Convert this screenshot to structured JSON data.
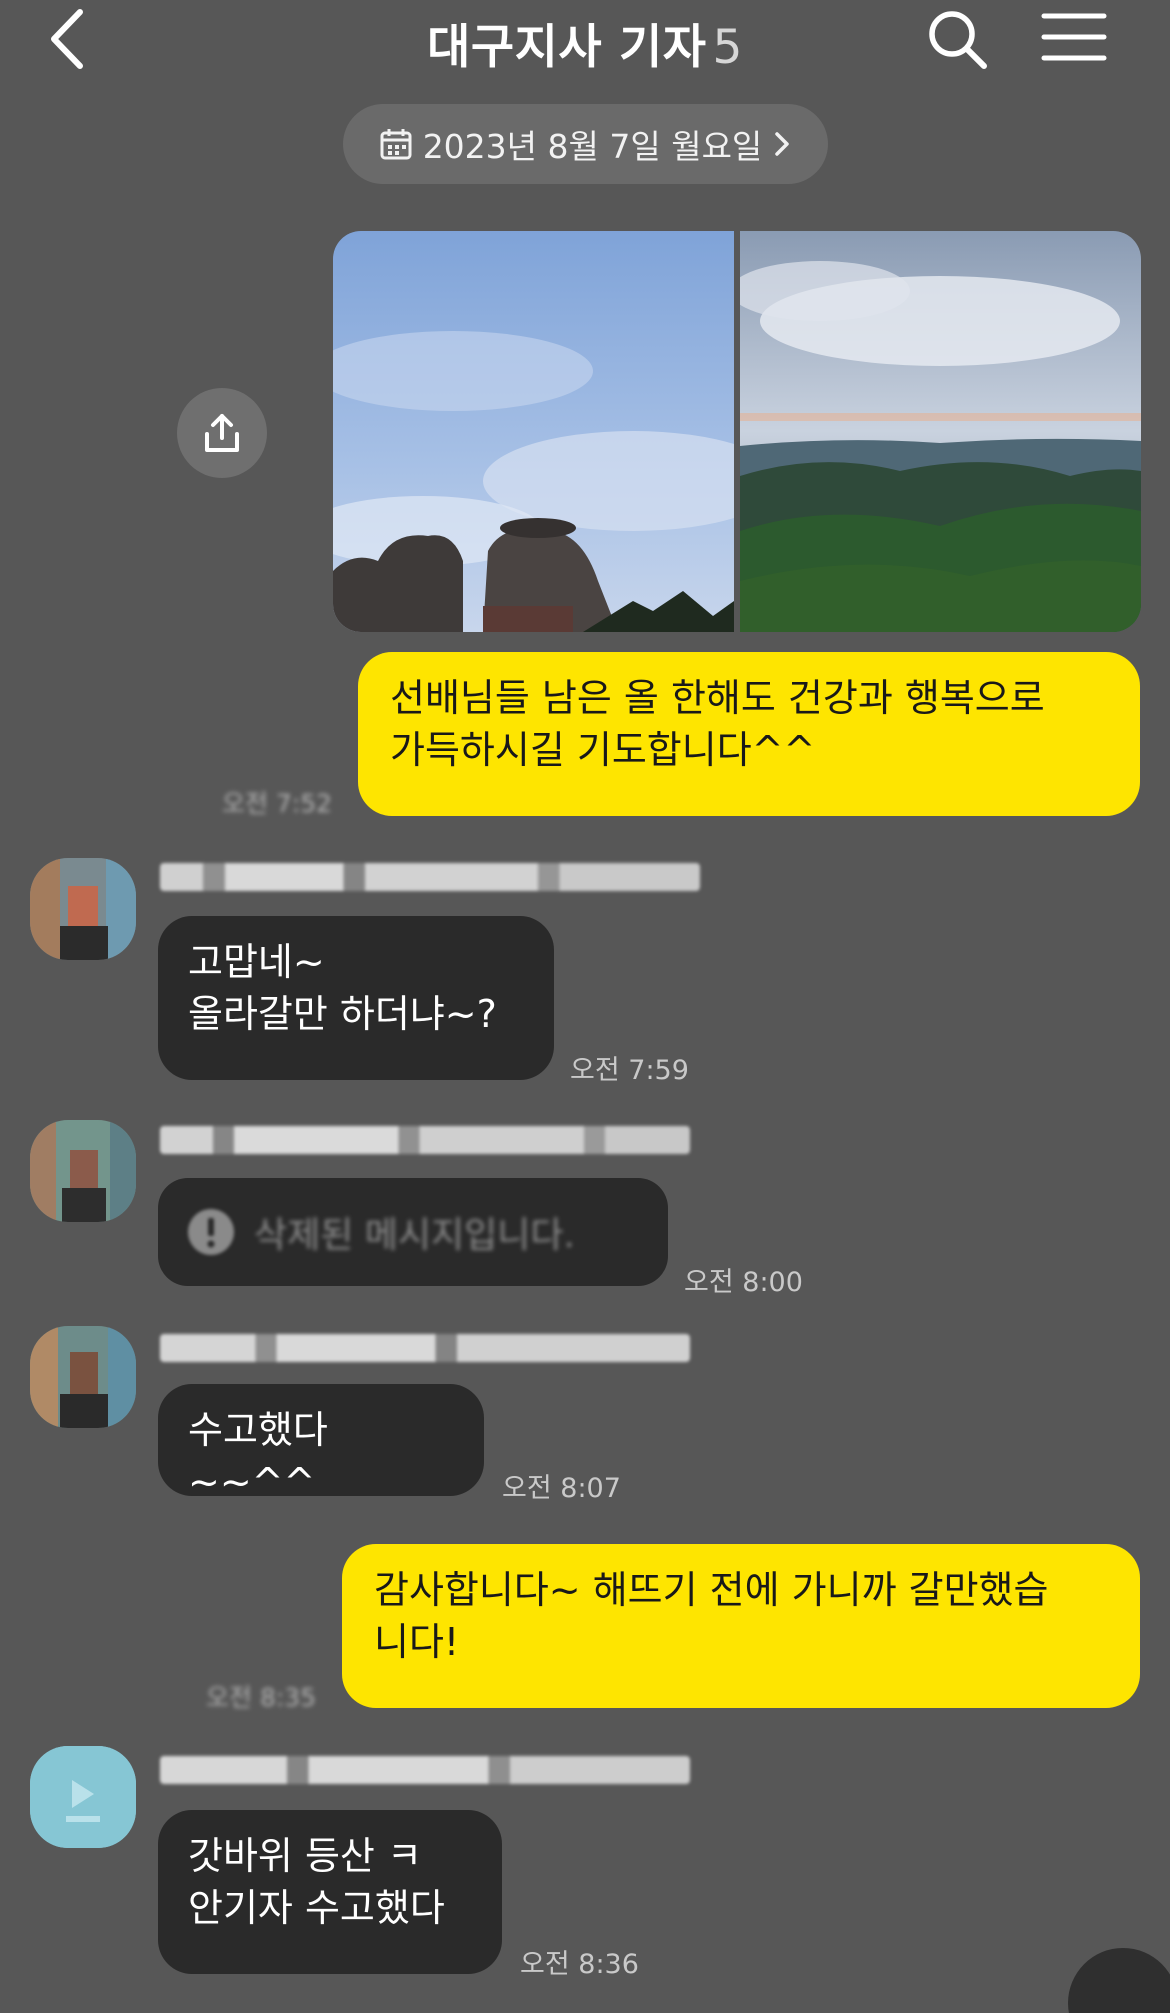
{
  "header": {
    "title": "대구지사 기자",
    "member_count": "5"
  },
  "date_bar": {
    "label": "2023년 8월 7일 월요일"
  },
  "messages": [
    {
      "sender": "me",
      "text": "선배님들 남은 올 한해도 건강과 행복으로\n가득하시길 기도합니다^^",
      "time": "오전 7:52"
    },
    {
      "sender": "other",
      "text": "고맙네~\n올라갈만 하더냐~?",
      "time": "오전 7:59"
    },
    {
      "sender": "other",
      "text": "삭제된 메시지입니다.",
      "time": "오전 8:00",
      "deleted": true
    },
    {
      "sender": "other",
      "text": "수고했다~~^^",
      "time": "오전 8:07"
    },
    {
      "sender": "me",
      "text": "감사합니다~ 해뜨기 전에 가니까 갈만했습\n니다!",
      "time": "오전 8:35"
    },
    {
      "sender": "other",
      "text": "갓바위 등산 ㅋ\n안기자 수고했다",
      "time": "오전 8:36"
    }
  ],
  "icons": {
    "back": "chevron-left-icon",
    "search": "search-icon",
    "menu": "menu-icon",
    "calendar": "calendar-icon",
    "share": "share-icon",
    "deleted": "exclamation-icon"
  },
  "colors": {
    "background": "#575757",
    "my_bubble": "#fee500",
    "other_bubble": "#2a2a2a"
  }
}
